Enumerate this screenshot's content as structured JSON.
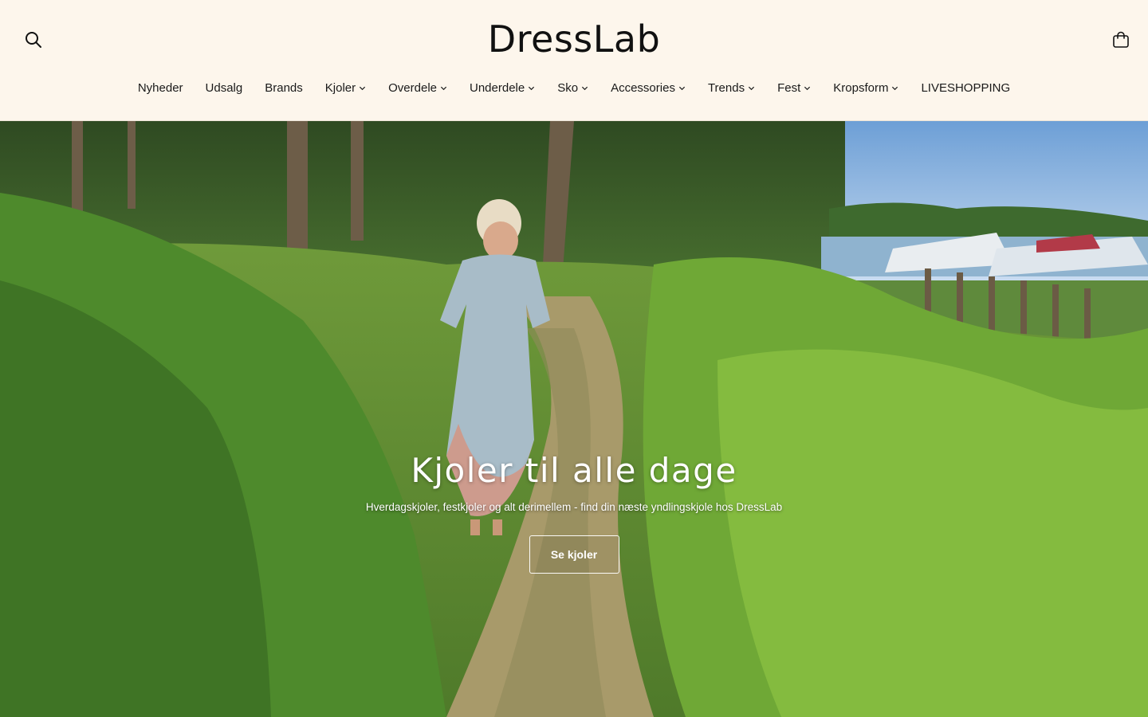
{
  "header": {
    "logo": "DressLab",
    "search_icon": "search-icon",
    "cart_icon": "shopping-bag-icon"
  },
  "nav": {
    "items": [
      {
        "label": "Nyheder",
        "dropdown": false
      },
      {
        "label": "Udsalg",
        "dropdown": false
      },
      {
        "label": "Brands",
        "dropdown": false
      },
      {
        "label": "Kjoler",
        "dropdown": true
      },
      {
        "label": "Overdele",
        "dropdown": true
      },
      {
        "label": "Underdele",
        "dropdown": true
      },
      {
        "label": "Sko",
        "dropdown": true
      },
      {
        "label": "Accessories",
        "dropdown": true
      },
      {
        "label": "Trends",
        "dropdown": true
      },
      {
        "label": "Fest",
        "dropdown": true
      },
      {
        "label": "Kropsform",
        "dropdown": true
      },
      {
        "label": "LIVESHOPPING",
        "dropdown": false
      }
    ]
  },
  "hero": {
    "title": "Kjoler til alle dage",
    "subtitle": "Hverdagskjoler, festkjoler og alt derimellem - find din næste yndlingskjole hos DressLab",
    "button_label": "Se kjoler"
  },
  "colors": {
    "header_bg": "#fdf6ec",
    "text": "#1a1a1a",
    "hero_text": "#ffffff"
  }
}
